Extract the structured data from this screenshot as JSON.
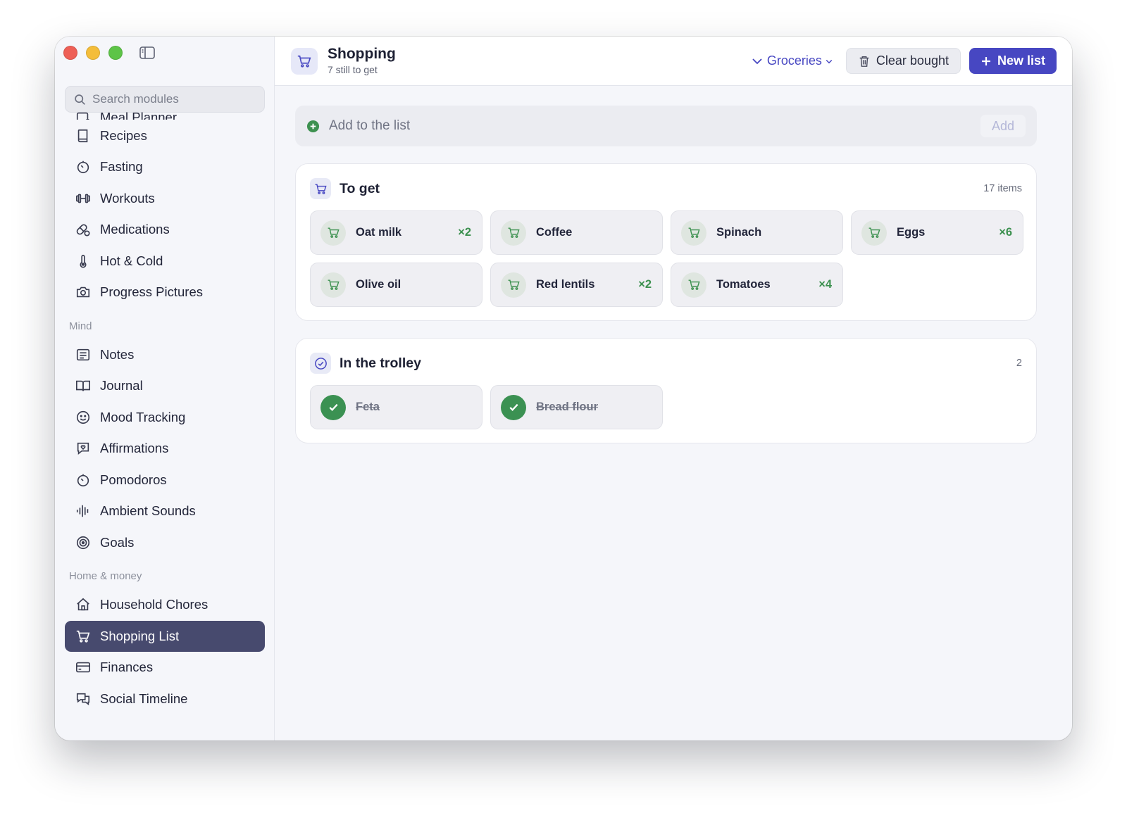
{
  "colors": {
    "accent": "#4747c2",
    "active_nav": "#474a6e",
    "green": "#3d9150"
  },
  "search": {
    "placeholder": "Search modules"
  },
  "sidebar": {
    "partial_item": "Meal Planner",
    "items_top": [
      {
        "label": "Recipes",
        "icon": "book-icon"
      },
      {
        "label": "Fasting",
        "icon": "timer-icon"
      },
      {
        "label": "Workouts",
        "icon": "dumbbell-icon"
      },
      {
        "label": "Medications",
        "icon": "pill-icon"
      },
      {
        "label": "Hot & Cold",
        "icon": "thermometer-icon"
      },
      {
        "label": "Progress Pictures",
        "icon": "camera-icon"
      }
    ],
    "section_mind": "Mind",
    "items_mind": [
      {
        "label": "Notes",
        "icon": "notes-icon"
      },
      {
        "label": "Journal",
        "icon": "open-book-icon"
      },
      {
        "label": "Mood Tracking",
        "icon": "smile-icon"
      },
      {
        "label": "Affirmations",
        "icon": "message-heart-icon"
      },
      {
        "label": "Pomodoros",
        "icon": "timer-icon"
      },
      {
        "label": "Ambient Sounds",
        "icon": "audio-wave-icon"
      },
      {
        "label": "Goals",
        "icon": "target-icon"
      }
    ],
    "section_home": "Home & money",
    "items_home": [
      {
        "label": "Household Chores",
        "icon": "house-icon"
      },
      {
        "label": "Shopping List",
        "icon": "cart-icon",
        "active": true
      },
      {
        "label": "Finances",
        "icon": "credit-card-icon"
      },
      {
        "label": "Social Timeline",
        "icon": "chat-bubbles-icon"
      }
    ]
  },
  "header": {
    "title": "Shopping",
    "subtitle": "7 still to get",
    "list_select": "Groceries",
    "clear_label": "Clear bought",
    "new_label": "New list"
  },
  "add_bar": {
    "placeholder": "Add to the list",
    "button": "Add"
  },
  "to_get": {
    "title": "To get",
    "count": "17 items",
    "items": [
      {
        "name": "Oat milk",
        "qty": "×2"
      },
      {
        "name": "Coffee",
        "qty": ""
      },
      {
        "name": "Spinach",
        "qty": ""
      },
      {
        "name": "Eggs",
        "qty": "×6"
      },
      {
        "name": "Olive oil",
        "qty": ""
      },
      {
        "name": "Red lentils",
        "qty": "×2"
      },
      {
        "name": "Tomatoes",
        "qty": "×4"
      }
    ]
  },
  "trolley": {
    "title": "In the trolley",
    "count": "2",
    "items": [
      {
        "name": "Feta"
      },
      {
        "name": "Bread flour"
      }
    ]
  }
}
